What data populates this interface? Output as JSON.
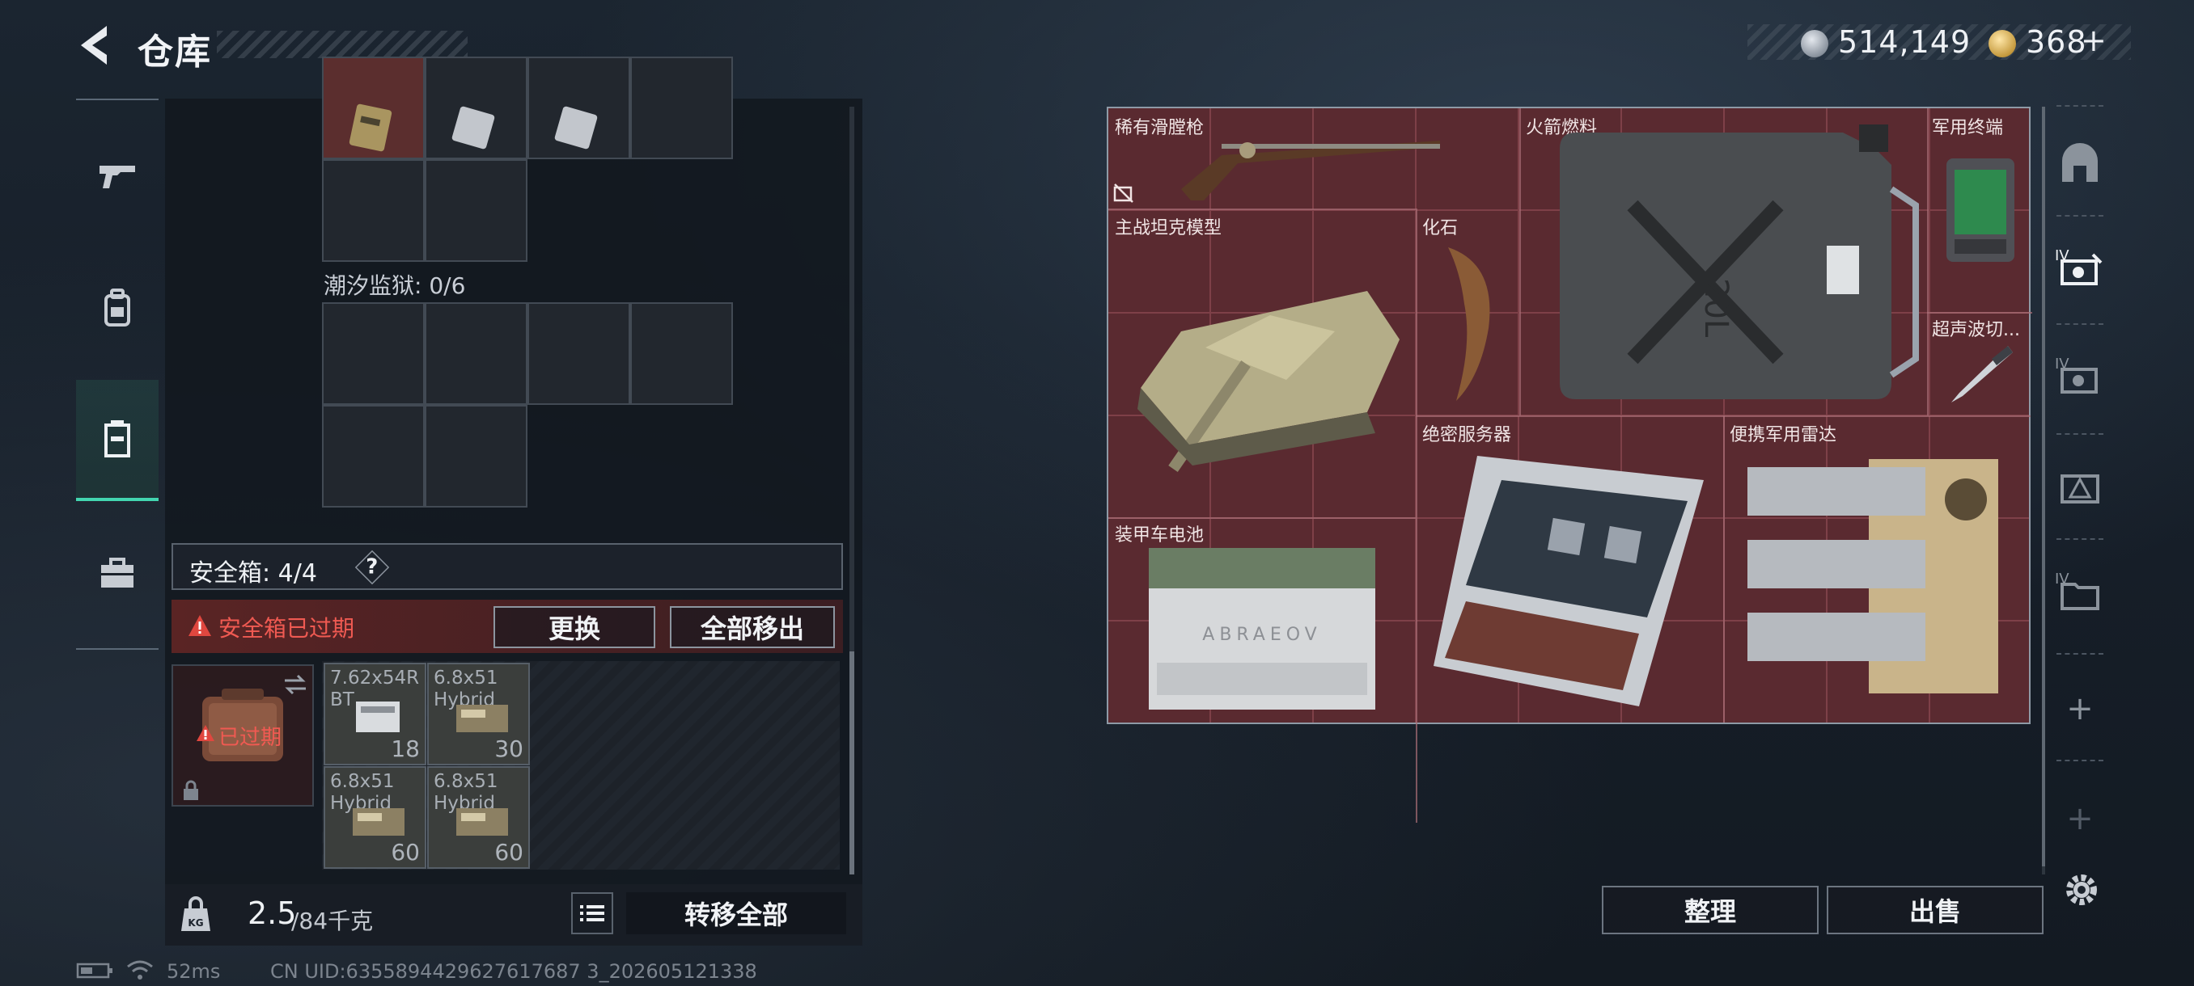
{
  "header": {
    "title": "仓库",
    "silver_amount": "514,149",
    "gold_amount": "368",
    "gold_plus": "+"
  },
  "left_nav": {
    "items": [
      {
        "name": "weapons",
        "icon": "gun-icon"
      },
      {
        "name": "gear",
        "icon": "backpack-icon"
      },
      {
        "name": "storage",
        "icon": "container-icon",
        "active": true
      },
      {
        "name": "toolkit",
        "icon": "briefcase-icon"
      }
    ]
  },
  "container_label": "潮汐监狱: 0/6",
  "safebox": {
    "label": "安全箱: 4/4",
    "help": "?",
    "expired_warning": "安全箱已过期",
    "replace_button": "更换",
    "move_all_button": "全部移出",
    "expired_tag": "已过期"
  },
  "ammo": [
    {
      "name": "7.62x54R BT",
      "qty": "18"
    },
    {
      "name": "6.8x51 Hybrid",
      "qty": "30"
    },
    {
      "name": "6.8x51 Hybrid",
      "qty": "60"
    },
    {
      "name": "6.8x51 Hybrid",
      "qty": "60"
    }
  ],
  "bottom": {
    "weight_current": "2.5",
    "weight_max": "/84千克",
    "transfer_all": "转移全部"
  },
  "stash_items": [
    {
      "label": "稀有滑膛枪"
    },
    {
      "label": "火箭燃料",
      "jerrycan_text": "20L"
    },
    {
      "label": "军用终端"
    },
    {
      "label": "主战坦克模型"
    },
    {
      "label": "化石"
    },
    {
      "label": "超声波切..."
    },
    {
      "label": "绝密服务器"
    },
    {
      "label": "便携军用雷达"
    },
    {
      "label": "装甲车电池",
      "battery_brand": "ABRAEOV"
    }
  ],
  "actions": {
    "sort": "整理",
    "sell": "出售"
  },
  "right_nav": {
    "tier_label": "IV",
    "add": "+"
  },
  "status": {
    "ping": "52ms",
    "uid": "CN UID:6355894429627617687 3_202605121338"
  },
  "colors": {
    "accent": "#43d6b0",
    "warning": "#e0473f",
    "stash_bg": "#5a2a30"
  }
}
